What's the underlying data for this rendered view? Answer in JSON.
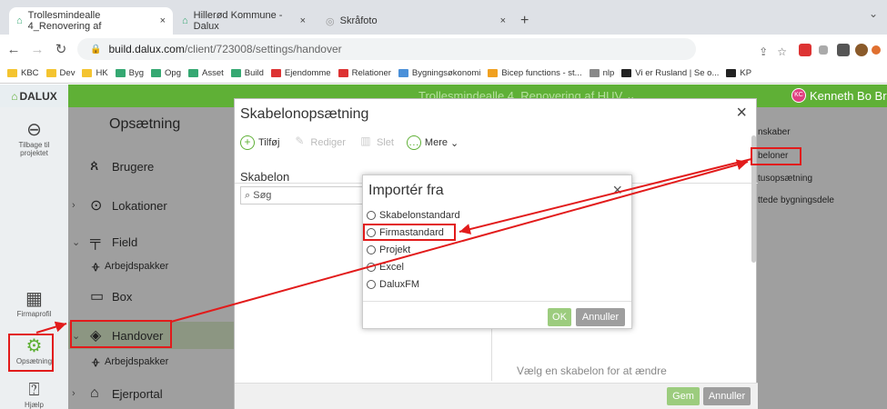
{
  "browser": {
    "tabs": [
      {
        "label": "Trollesmindealle 4_Renovering af",
        "close": "×"
      },
      {
        "label": "Hillerød Kommune - Dalux",
        "close": "×"
      },
      {
        "label": "Skråfoto",
        "close": "×"
      }
    ],
    "new_tab": "+",
    "url_domain": "build.dalux.com",
    "url_path": "/client/723008/settings/handover",
    "bookmarks": [
      {
        "label": "KBC",
        "color": "#f4c430"
      },
      {
        "label": "Dev",
        "color": "#f4c430"
      },
      {
        "label": "HK",
        "color": "#f4c430"
      },
      {
        "label": "Byg",
        "color": "#35a872"
      },
      {
        "label": "Opg",
        "color": "#35a872"
      },
      {
        "label": "Asset",
        "color": "#35a872"
      },
      {
        "label": "Build",
        "color": "#35a872"
      },
      {
        "label": "Ejendomme",
        "color": "#d33"
      },
      {
        "label": "Relationer",
        "color": "#d33"
      },
      {
        "label": "Bygningsøkonomi",
        "color": "#4a90d9"
      },
      {
        "label": "Bicep functions - st...",
        "color": "#f0a020"
      },
      {
        "label": "nlp",
        "color": "#888"
      },
      {
        "label": "Vi er Rusland | Se o...",
        "color": "#222"
      },
      {
        "label": "KP",
        "color": "#222"
      }
    ]
  },
  "app": {
    "logo": "DALUX",
    "project_title": "Trollesmindealle 4_Renovering af HUV",
    "user_initials": "KC",
    "user_name": "Kenneth Bo Br",
    "rail": {
      "back": "Tilbage til projektet",
      "company_profile": "Firmaprofil",
      "settings": "Opsætning",
      "help": "Hjælp"
    },
    "sidebar": {
      "title": "Opsætning",
      "items": [
        {
          "label": "Brugere"
        },
        {
          "label": "Lokationer"
        },
        {
          "label": "Field"
        },
        {
          "label": "Arbejdspakker"
        },
        {
          "label": "Box"
        },
        {
          "label": "Handover"
        },
        {
          "label": "Arbejdspakker"
        },
        {
          "label": "Ejerportal"
        }
      ]
    },
    "right_panel": {
      "items": [
        "nskaber",
        "beloner",
        "tusopsætning",
        "ttede bygningsdele"
      ]
    }
  },
  "modal": {
    "title": "Skabelonopsætning",
    "close": "×",
    "toolbar": {
      "add": "Tilføj",
      "edit": "Rediger",
      "delete": "Slet",
      "more": "Mere"
    },
    "column_header": "Skabelon",
    "search_placeholder": "Søg",
    "empty_hint": "Vælg en skabelon for at ændre",
    "save": "Gem",
    "cancel": "Annuller"
  },
  "dialog": {
    "title": "Importér fra",
    "close": "×",
    "options": [
      "Skabelonstandard",
      "Firmastandard",
      "Projekt",
      "Excel",
      "DaluxFM"
    ],
    "ok": "OK",
    "cancel": "Annuller"
  },
  "colors": {
    "brand_green": "#5fb036",
    "highlight_red": "#e21b1b"
  }
}
